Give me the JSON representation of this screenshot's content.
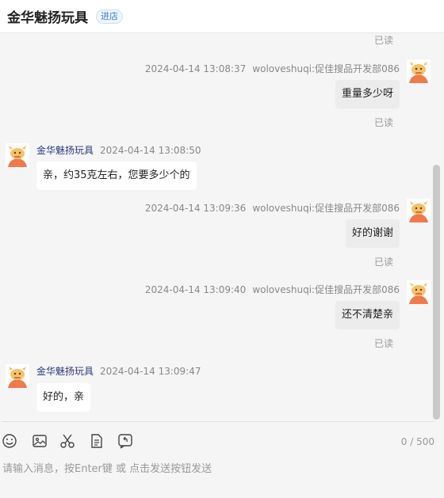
{
  "header": {
    "shop_name": "金华魅扬玩具",
    "enter_label": "进店"
  },
  "messages": {
    "top_read": "已读",
    "m1": {
      "time": "2024-04-14 13:08:37",
      "sender": "woloveshuqi:促佳搜品开发部086",
      "text": "重量多少呀",
      "read": "已读"
    },
    "m2": {
      "time": "2024-04-14 13:08:50",
      "sender": "金华魅扬玩具",
      "text": "亲，约35克左右，您要多少个的"
    },
    "m3": {
      "time": "2024-04-14 13:09:36",
      "sender": "woloveshuqi:促佳搜品开发部086",
      "text": "好的谢谢",
      "read": "已读"
    },
    "m4": {
      "time": "2024-04-14 13:09:40",
      "sender": "woloveshuqi:促佳搜品开发部086",
      "text": "还不清楚亲",
      "read": "已读"
    },
    "m5": {
      "time": "2024-04-14 13:09:47",
      "sender": "金华魅扬玩具",
      "text": "好的，亲"
    }
  },
  "composer": {
    "tools": [
      "smile-icon",
      "image-icon",
      "scissors-icon",
      "document-icon",
      "recall-icon"
    ],
    "counter": "0 / 500",
    "placeholder": "请输入消息，按Enter键 或 点击发送按钮发送"
  }
}
